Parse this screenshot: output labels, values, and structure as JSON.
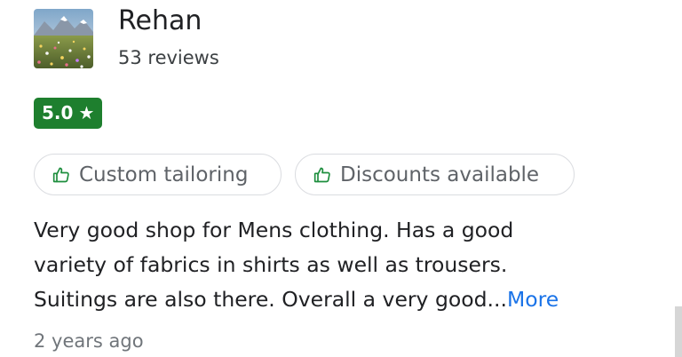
{
  "reviewer": {
    "name": "Rehan",
    "review_count": "53 reviews"
  },
  "rating": {
    "value": "5.0",
    "star": "★"
  },
  "chips": [
    {
      "label": "Custom tailoring",
      "icon": "thumbs-up-icon"
    },
    {
      "label": "Discounts available",
      "icon": "thumbs-up-icon"
    }
  ],
  "review": {
    "line1": "Very good shop for Mens clothing. Has a good",
    "line2": "variety of fabrics in shirts as well as trousers.",
    "line3": "Suitings are also there. Overall a very good...",
    "more": "More"
  },
  "timestamp": "2 years ago",
  "colors": {
    "rating_badge": "#1e7f2e",
    "link": "#1a73e8"
  }
}
